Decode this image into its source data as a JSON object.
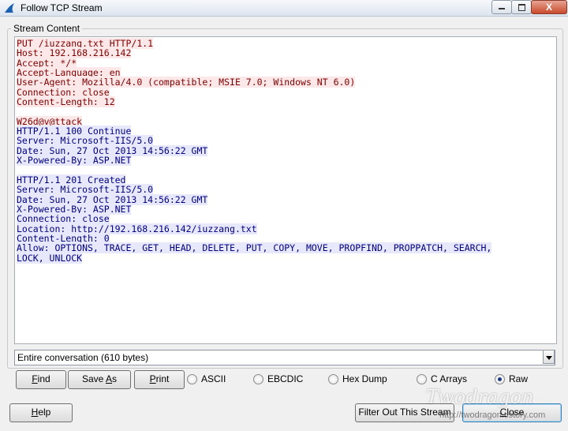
{
  "window": {
    "title": "Follow TCP Stream",
    "close_glyph": "X"
  },
  "stream_group_label": "Stream Content",
  "stream": {
    "client1": "PUT /iuzzang.txt HTTP/1.1\nHost: 192.168.216.142\nAccept: */*\nAccept-Language: en\nUser-Agent: Mozilla/4.0 (compatible; MSIE 7.0; Windows NT 6.0)\nConnection: close\nContent-Length: 12",
    "client2": "W26d@v@ttack",
    "server1": "HTTP/1.1 100 Continue\nServer: Microsoft-IIS/5.0\nDate: Sun, 27 Oct 2013 14:56:22 GMT\nX-Powered-By: ASP.NET",
    "server2": "HTTP/1.1 201 Created\nServer: Microsoft-IIS/5.0\nDate: Sun, 27 Oct 2013 14:56:22 GMT\nX-Powered-By: ASP.NET\nConnection: close\nLocation: http://192.168.216.142/iuzzang.txt\nContent-Length: 0\nAllow: OPTIONS, TRACE, GET, HEAD, DELETE, PUT, COPY, MOVE, PROPFIND, PROPPATCH, SEARCH,\nLOCK, UNLOCK"
  },
  "conversation_select": {
    "value": "Entire conversation (610 bytes)"
  },
  "buttons": {
    "find": {
      "accel": "F",
      "rest": "ind"
    },
    "save_as": {
      "pre": "Save ",
      "accel": "A",
      "rest": "s"
    },
    "print": {
      "accel": "P",
      "rest": "rint"
    },
    "help": {
      "accel": "H",
      "rest": "elp"
    },
    "filter_out": "Filter Out This Stream",
    "close": {
      "accel": "C",
      "rest": "lose"
    }
  },
  "format_options": [
    {
      "label": "ASCII",
      "selected": false
    },
    {
      "label": "EBCDIC",
      "selected": false
    },
    {
      "label": "Hex Dump",
      "selected": false
    },
    {
      "label": "C Arrays",
      "selected": false
    },
    {
      "label": "Raw",
      "selected": true
    }
  ],
  "watermark": {
    "text": "Twodragon",
    "url": "http://twodragon.tistory.com"
  },
  "colors": {
    "client_text": "#7f0000",
    "server_text": "#00007f"
  },
  "icons": {
    "app": "shark-fin-icon",
    "window_min": "minimize-icon",
    "window_max": "maximize-icon",
    "window_close": "close-icon",
    "dropdown": "chevron-down-icon"
  }
}
